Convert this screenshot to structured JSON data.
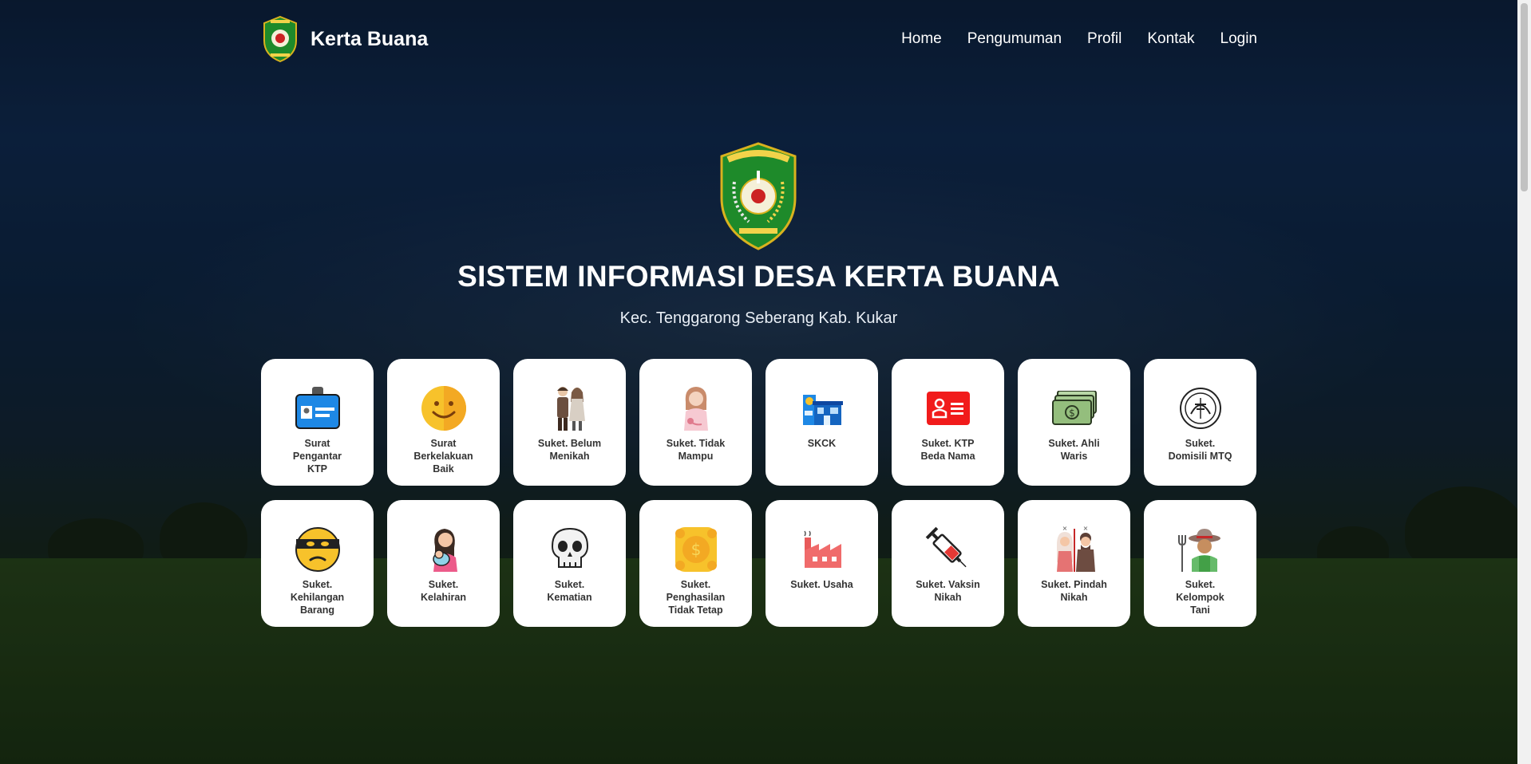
{
  "brand": {
    "name": "Kerta Buana"
  },
  "nav": {
    "items": [
      "Home",
      "Pengumuman",
      "Profil",
      "Kontak",
      "Login"
    ]
  },
  "hero": {
    "title": "SISTEM INFORMASI DESA KERTA BUANA",
    "subtitle": "Kec. Tenggarong Seberang Kab. Kukar"
  },
  "services": [
    {
      "label": "Surat\nPengantar\nKTP",
      "icon": "id-card-icon"
    },
    {
      "label": "Surat\nBerkelakuan\nBaik",
      "icon": "smiley-icon"
    },
    {
      "label": "Suket. Belum\nMenikah",
      "icon": "couple-icon"
    },
    {
      "label": "Suket. Tidak\nMampu",
      "icon": "woman-icon"
    },
    {
      "label": "SKCK",
      "icon": "police-station-icon"
    },
    {
      "label": "Suket. KTP\nBeda Nama",
      "icon": "red-id-icon"
    },
    {
      "label": "Suket. Ahli\nWaris",
      "icon": "money-icon"
    },
    {
      "label": "Suket.\nDomisili MTQ",
      "icon": "quran-emblem-icon"
    },
    {
      "label": "Suket.\nKehilangan\nBarang",
      "icon": "thief-icon"
    },
    {
      "label": "Suket.\nKelahiran",
      "icon": "mother-baby-icon"
    },
    {
      "label": "Suket.\nKematian",
      "icon": "skull-icon"
    },
    {
      "label": "Suket.\nPenghasilan\nTidak Tetap",
      "icon": "coin-icon"
    },
    {
      "label": "Suket. Usaha",
      "icon": "factory-icon"
    },
    {
      "label": "Suket. Vaksin\nNikah",
      "icon": "syringe-icon"
    },
    {
      "label": "Suket. Pindah\nNikah",
      "icon": "moving-couple-icon"
    },
    {
      "label": "Suket.\nKelompok\nTani",
      "icon": "farmer-icon"
    }
  ]
}
